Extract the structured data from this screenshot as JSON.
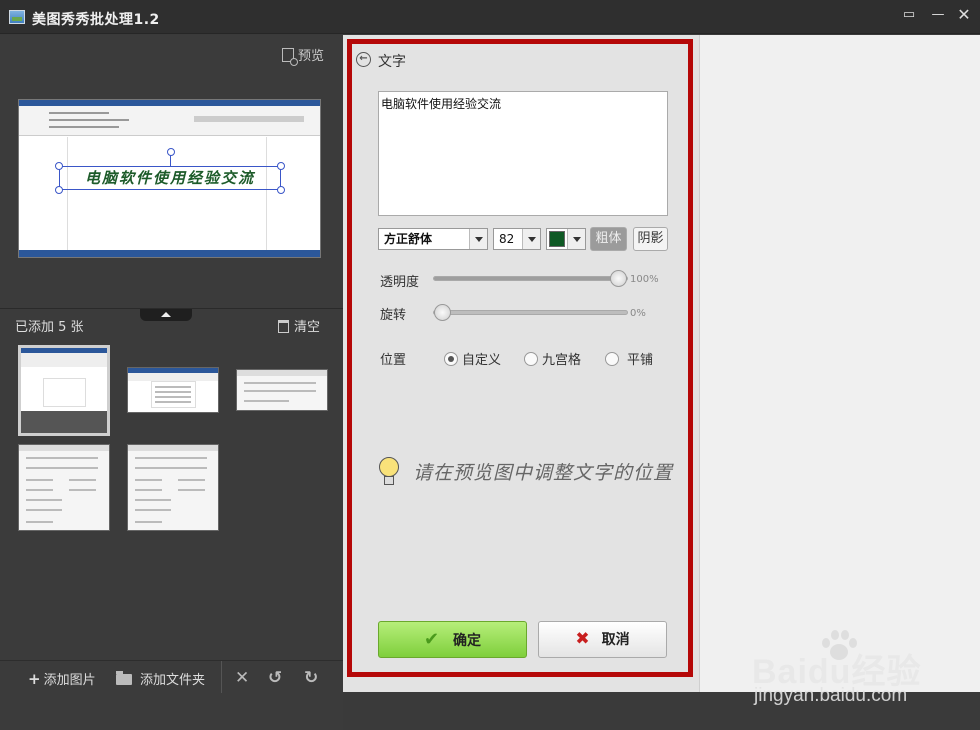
{
  "window": {
    "title": "美图秀秀批处理1.2",
    "buttons": [
      "feedback-icon",
      "minimize-icon",
      "close-icon"
    ]
  },
  "left": {
    "preview_label": "预览",
    "preview_doc_text": "电脑软件使用经验交流",
    "added_count": "已添加 5 张",
    "clear_label": "清空",
    "thumbnails": [
      {
        "kind": "word-doc",
        "selected": true
      },
      {
        "kind": "word-doc",
        "selected": false
      },
      {
        "kind": "dialog",
        "selected": false
      },
      {
        "kind": "dialog",
        "selected": false
      },
      {
        "kind": "dialog",
        "selected": false
      }
    ],
    "toolbar": {
      "add_image": "添加图片",
      "add_folder": "添加文件夹",
      "icons": [
        "delete-icon",
        "rotate-left-icon",
        "rotate-right-icon"
      ]
    }
  },
  "editor": {
    "title": "文字",
    "text_value": "电脑软件使用经验交流",
    "font": "方正舒体",
    "size": "82",
    "color": "#0f5a25",
    "bold_label": "粗体",
    "bold_active": true,
    "shadow_label": "阴影",
    "opacity": {
      "label": "透明度",
      "value": "100%",
      "level": 1.0
    },
    "rotation": {
      "label": "旋转",
      "value": "0%",
      "level": 0.0
    },
    "position": {
      "label": "位置",
      "options": [
        "自定义",
        "九宫格",
        "平铺"
      ],
      "selected": "自定义"
    },
    "hint": "请在预览图中调整文字的位置",
    "confirm_label": "确定",
    "cancel_label": "取消",
    "highlight_color": "#b50808"
  },
  "watermark": {
    "brand": "Baidu经验",
    "url": "jingyan.baidu.com"
  }
}
